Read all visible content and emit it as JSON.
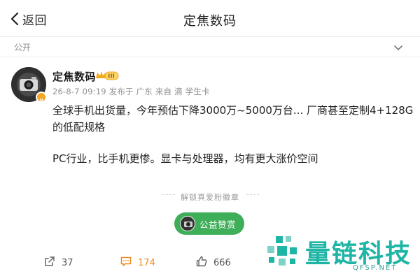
{
  "navbar": {
    "back_label": "返回",
    "title": "定焦数码"
  },
  "visibility": {
    "label": "公开"
  },
  "post": {
    "author": "定焦数码",
    "vip_badge_icon": "vip-crown-icon",
    "meta": "26-8-7 09:19 发布于 广东 来自 滴 学生卡",
    "paragraph1": "全球手机出货量，今年预估下降3000万~5000万台... 厂商甚至定制4+128G的低配规格",
    "paragraph2": "PC行业，比手机更惨。显卡与处理器，均有更大涨价空间"
  },
  "unlock": {
    "label": "解锁真爱粉徽章"
  },
  "reward": {
    "label": "公益赞赏"
  },
  "actions": {
    "repost_count": "37",
    "comment_count": "174",
    "like_count": "666"
  },
  "watermark": {
    "text": "量链科技",
    "sub": "QFSP.NET"
  },
  "colors": {
    "reward_green": "#3fae58",
    "comment_orange": "#f08a24",
    "watermark_teal": "#1fb5a5"
  }
}
